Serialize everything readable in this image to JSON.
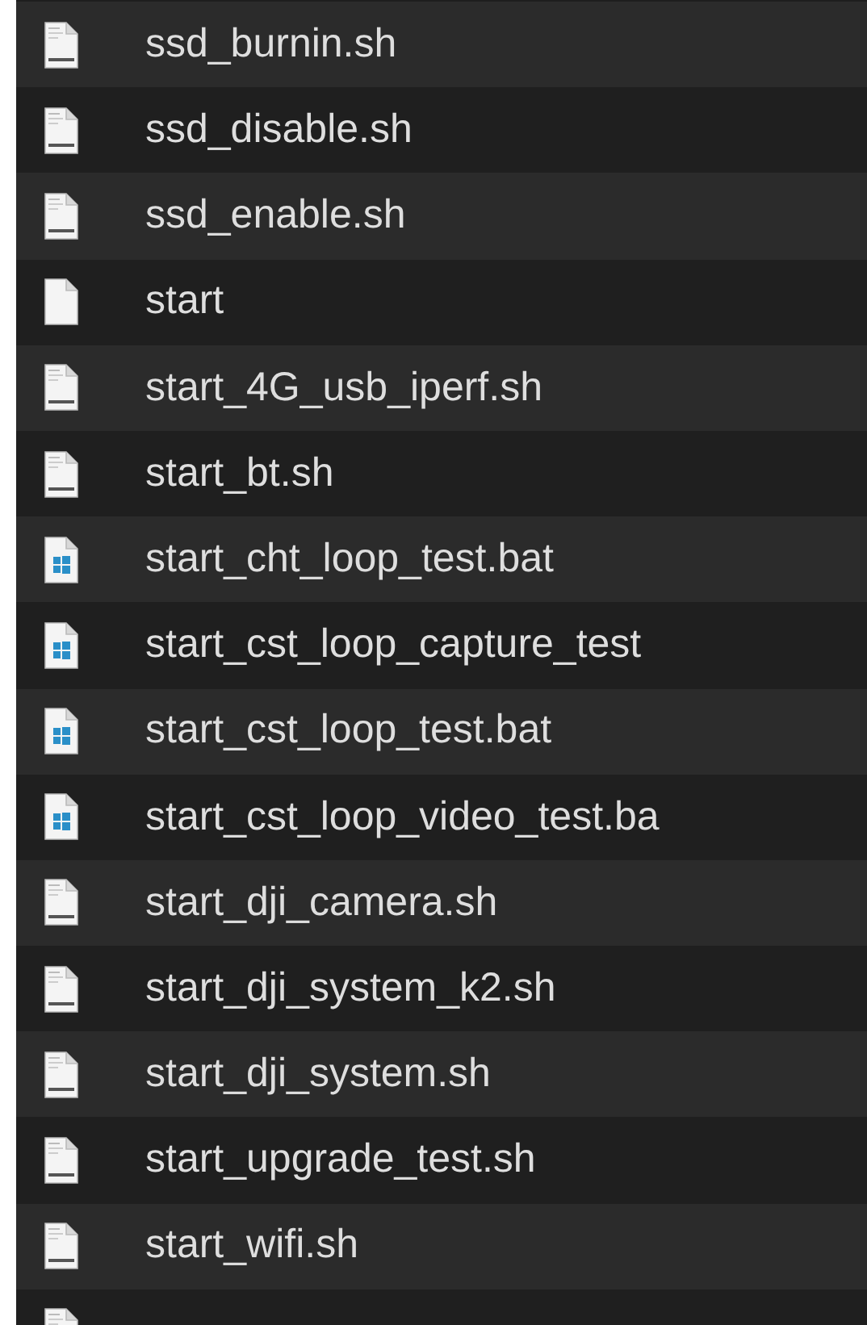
{
  "files": [
    {
      "name": "ssd_burnin.sh",
      "kind": "shell"
    },
    {
      "name": "ssd_disable.sh",
      "kind": "shell"
    },
    {
      "name": "ssd_enable.sh",
      "kind": "shell"
    },
    {
      "name": "start",
      "kind": "plain"
    },
    {
      "name": "start_4G_usb_iperf.sh",
      "kind": "shell"
    },
    {
      "name": "start_bt.sh",
      "kind": "shell"
    },
    {
      "name": "start_cht_loop_test.bat",
      "kind": "windows"
    },
    {
      "name": "start_cst_loop_capture_test",
      "kind": "windows"
    },
    {
      "name": "start_cst_loop_test.bat",
      "kind": "windows"
    },
    {
      "name": "start_cst_loop_video_test.ba",
      "kind": "windows"
    },
    {
      "name": "start_dji_camera.sh",
      "kind": "shell"
    },
    {
      "name": "start_dji_system_k2.sh",
      "kind": "shell"
    },
    {
      "name": "start_dji_system.sh",
      "kind": "shell"
    },
    {
      "name": "start_upgrade_test.sh",
      "kind": "shell"
    },
    {
      "name": "start_wifi.sh",
      "kind": "shell"
    },
    {
      "kind": "shell"
    }
  ]
}
